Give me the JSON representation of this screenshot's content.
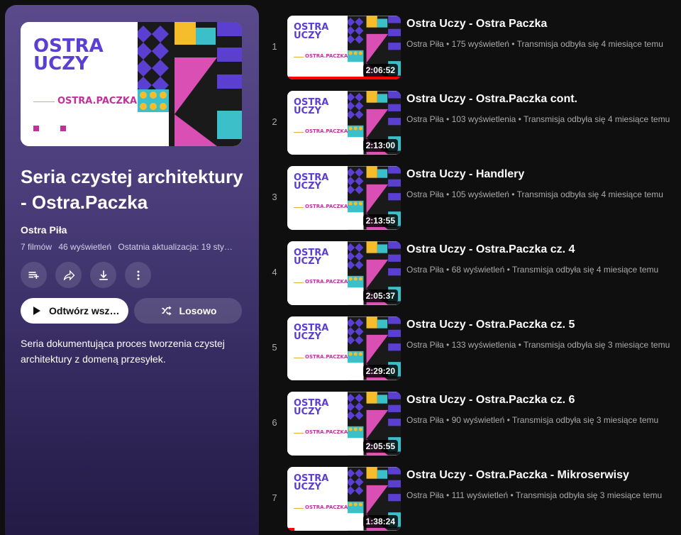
{
  "playlist": {
    "title": "Seria czystej architektury - Ostra.Paczka",
    "owner": "Ostra Piła",
    "video_count": "7 filmów",
    "views": "46 wyświetleń",
    "last_update": "Ostatnia aktualizacja: 19 sty…",
    "play_label": "Odtwórz wsz…",
    "shuffle_label": "Losowo",
    "description": "Seria dokumentująca proces tworzenia czystej architektury z domeną przesyłek.",
    "hero": {
      "line1": "OSTRA",
      "line2": "UCZY",
      "tagline": "OSTRA.PACZKA"
    },
    "icons": [
      "add-to-queue-icon",
      "share-icon",
      "download-icon",
      "more-icon"
    ]
  },
  "videos": [
    {
      "index": "1",
      "title": "Ostra Uczy - Ostra Paczka",
      "channel": "Ostra Piła",
      "views": "175 wyświetleń",
      "age": "Transmisja odbyła się 4 miesiące temu",
      "duration": "2:06:52",
      "watched": 1.0
    },
    {
      "index": "2",
      "title": "Ostra Uczy - Ostra.Paczka cont.",
      "channel": "Ostra Piła",
      "views": "103 wyświetlenia",
      "age": "Transmisja odbyła się 4 miesiące temu",
      "duration": "2:13:00",
      "watched": 0
    },
    {
      "index": "3",
      "title": "Ostra Uczy - Handlery",
      "channel": "Ostra Piła",
      "views": "105 wyświetleń",
      "age": "Transmisja odbyła się 4 miesiące temu",
      "duration": "2:13:55",
      "watched": 0
    },
    {
      "index": "4",
      "title": "Ostra Uczy - Ostra.Paczka cz. 4",
      "channel": "Ostra Piła",
      "views": "68 wyświetleń",
      "age": "Transmisja odbyła się 4 miesiące temu",
      "duration": "2:05:37",
      "watched": 0
    },
    {
      "index": "5",
      "title": "Ostra Uczy - Ostra.Paczka cz. 5",
      "channel": "Ostra Piła",
      "views": "133 wyświetlenia",
      "age": "Transmisja odbyła się 3 miesiące temu",
      "duration": "2:29:20",
      "watched": 0
    },
    {
      "index": "6",
      "title": "Ostra Uczy - Ostra.Paczka cz. 6",
      "channel": "Ostra Piła",
      "views": "90 wyświetleń",
      "age": "Transmisja odbyła się 3 miesiące temu",
      "duration": "2:05:55",
      "watched": 0
    },
    {
      "index": "7",
      "title": "Ostra Uczy - Ostra.Paczka - Mikroserwisy",
      "channel": "Ostra Piła",
      "views": "111 wyświetleń",
      "age": "Transmisja odbyła się 3 miesiące temu",
      "duration": "1:38:24",
      "watched": 0.06
    }
  ],
  "colors": {
    "accent_purple": "#5b3fd1",
    "accent_pink": "#d94fb3",
    "accent_yellow": "#f5bd2c",
    "accent_teal": "#3bbfc9",
    "progress_red": "#ff0000"
  }
}
